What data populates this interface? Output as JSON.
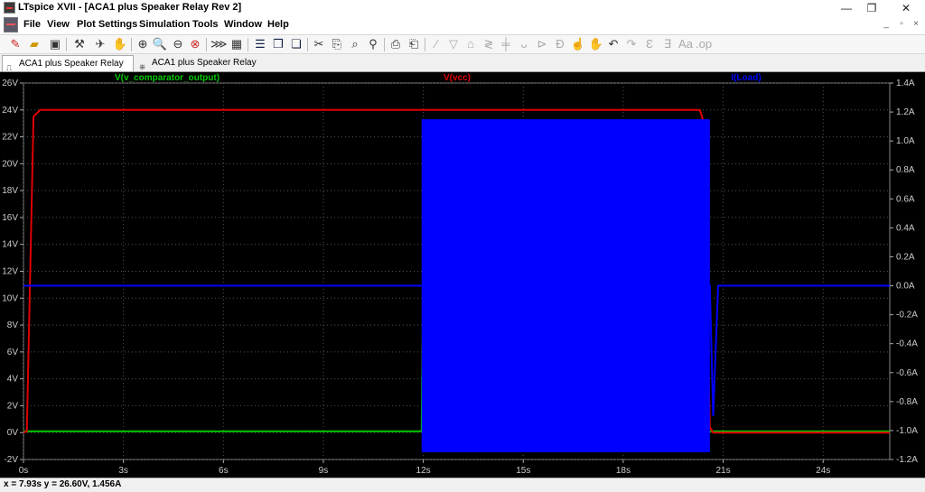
{
  "window": {
    "title": "LTspice XVII - [ACA1 plus Speaker Relay Rev 2]",
    "minimize_glyph": "—",
    "restore_glyph": "❐",
    "close_glyph": "✕"
  },
  "menu": {
    "items": [
      "File",
      "View",
      "Plot Settings",
      "Simulation",
      "Tools",
      "Window",
      "Help"
    ],
    "mdi_minimize": "_",
    "mdi_restore": "▫",
    "mdi_close": "×"
  },
  "toolbar": {
    "icons": [
      "new-schematic-icon",
      "open-icon",
      "save-icon",
      "control-panel-icon",
      "run-icon",
      "halt-icon",
      "zoom-full-icon",
      "zoom-in-icon",
      "zoom-out-icon",
      "zoom-cancel-icon",
      "autorange-icon",
      "area-icon",
      "tile-horizontal-icon",
      "tile-vertical-icon",
      "cascade-icon",
      "cut-icon",
      "copy-icon",
      "find-icon",
      "print-icon",
      "print-preview-icon",
      "wire-icon",
      "ground-icon",
      "label-icon",
      "resistor-icon",
      "capacitor-icon",
      "inductor-icon",
      "diode-icon",
      "component-icon",
      "move-icon",
      "drag-icon",
      "undo-icon",
      "redo-icon",
      "rotate-icon",
      "mirror-icon",
      "text-icon",
      "spice-directive-icon"
    ]
  },
  "tabs": [
    {
      "label": "ACA1 plus Speaker Relay Rev 2",
      "active": true,
      "icon": "waveform-icon"
    },
    {
      "label": "ACA1 plus Speaker Relay Rev 2",
      "active": false,
      "icon": "schematic-icon"
    }
  ],
  "status": {
    "text": "x = 7.93s   y = 26.60V, 1.456A"
  },
  "chart_data": {
    "type": "line",
    "title": "",
    "background": "#000000",
    "grid": true,
    "grid_color": "#555555",
    "xlabel": "",
    "ylabel": "",
    "ylabel_right": "",
    "xlim": [
      0,
      26
    ],
    "ylim_left": [
      -2,
      26
    ],
    "ylim_right": [
      -1.2,
      1.4
    ],
    "x_ticks": [
      "0s",
      "3s",
      "6s",
      "9s",
      "12s",
      "15s",
      "18s",
      "21s",
      "24s"
    ],
    "x_tick_values": [
      0,
      3,
      6,
      9,
      12,
      15,
      18,
      21,
      24
    ],
    "y_ticks_left": [
      "26V",
      "24V",
      "22V",
      "20V",
      "18V",
      "16V",
      "14V",
      "12V",
      "10V",
      "8V",
      "6V",
      "4V",
      "2V",
      "0V",
      "-2V"
    ],
    "y_tick_values_left": [
      26,
      24,
      22,
      20,
      18,
      16,
      14,
      12,
      10,
      8,
      6,
      4,
      2,
      0,
      -2
    ],
    "y_ticks_right": [
      "1.4A",
      "1.2A",
      "1.0A",
      "0.8A",
      "0.6A",
      "0.4A",
      "0.2A",
      "0.0A",
      "-0.2A",
      "-0.4A",
      "-0.6A",
      "-0.8A",
      "-1.0A",
      "-1.2A"
    ],
    "y_tick_values_right": [
      1.4,
      1.2,
      1.0,
      0.8,
      0.6,
      0.4,
      0.2,
      0.0,
      -0.2,
      -0.4,
      -0.6,
      -0.8,
      -1.0,
      -1.2
    ],
    "series": [
      {
        "name": "V(v_comparator_output)",
        "axis": "left",
        "color": "#00c800",
        "x": [
          0,
          11.95,
          12.0,
          12.0,
          20.5,
          26
        ],
        "y": [
          0.1,
          0.1,
          13.2,
          0.1,
          0.1,
          0.1
        ]
      },
      {
        "name": "V(vcc)",
        "axis": "left",
        "color": "#e00000",
        "x": [
          0,
          0.1,
          0.3,
          0.5,
          20.3,
          20.4,
          20.6,
          20.7,
          26
        ],
        "y": [
          0,
          0.1,
          23.5,
          24,
          24,
          23.2,
          0.4,
          0,
          0
        ]
      },
      {
        "name": "I(Load)",
        "axis": "right",
        "color": "#0000ff",
        "x": [
          0,
          11.95,
          20.6,
          20.7,
          20.85,
          26
        ],
        "y": [
          0.0,
          0.0,
          0.0,
          -0.9,
          0.0,
          0.0
        ],
        "oscillation": {
          "x_start": 11.95,
          "x_end": 20.6,
          "max": 1.15,
          "min": -1.15
        }
      }
    ]
  }
}
